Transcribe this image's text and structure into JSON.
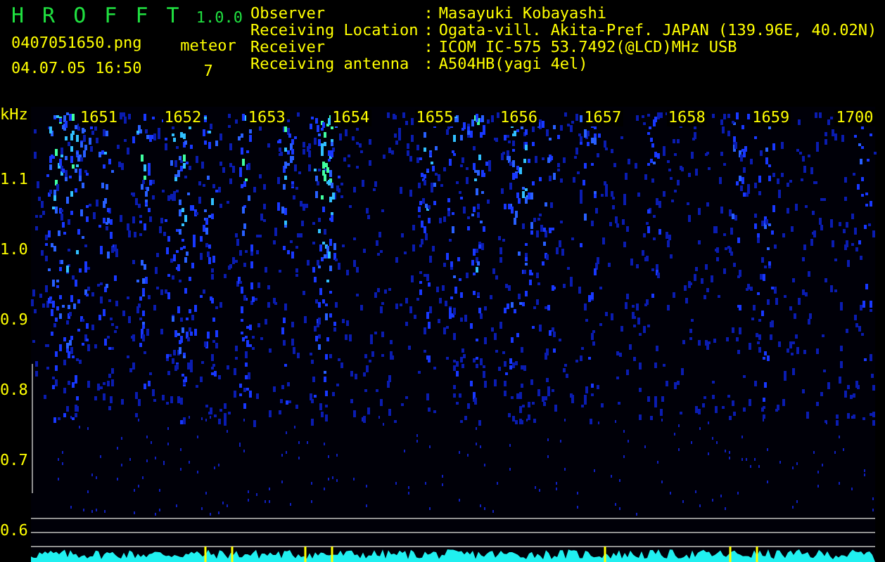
{
  "header": {
    "app_name": "H R O F F T",
    "version": "1.0.0",
    "file_name": "0407051650.png",
    "date_time": "04.07.05 16:50",
    "meteor_label": "meteor",
    "meteor_count": "7"
  },
  "station_info": [
    {
      "label": "Observer",
      "separator": ":",
      "value": "Masayuki Kobayashi"
    },
    {
      "label": "Receiving Location",
      "separator": ":",
      "value": "Ogata-vill. Akita-Pref. JAPAN (139.96E, 40.02N)"
    },
    {
      "label": "Receiver",
      "separator": ":",
      "value": "ICOM IC-575 53.7492(@LCD)MHz USB"
    },
    {
      "label": "Receiving antenna",
      "separator": ":",
      "value": "A504HB(yagi 4el)"
    }
  ],
  "spectrogram": {
    "unit": "kHz",
    "frequency_labels": [
      "1.1",
      "1.0",
      "0.9",
      "0.8",
      "0.7",
      "0.6"
    ],
    "time_labels": [
      "1651",
      "1652",
      "1653",
      "1654",
      "1655",
      "1656",
      "1657",
      "1658",
      "1659",
      "1700"
    ]
  }
}
